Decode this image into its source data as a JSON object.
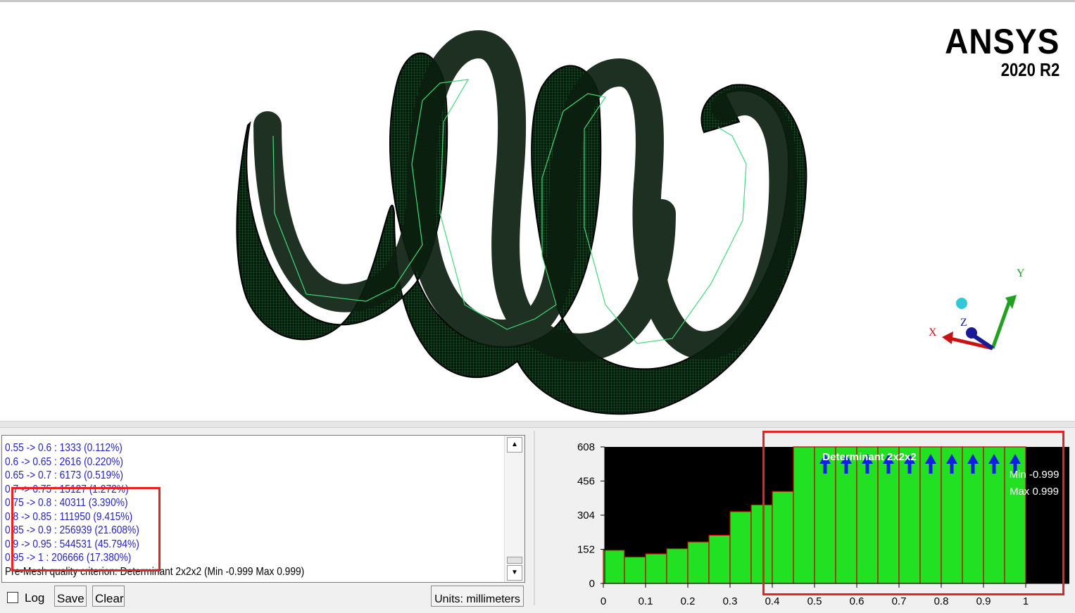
{
  "brand": {
    "name": "ANSYS",
    "version": "2020 R2"
  },
  "axes_triad": {
    "x": "X",
    "y": "Y",
    "z": "Z"
  },
  "log": {
    "lines": [
      "0.55 -> 0.6 : 1333 (0.112%)",
      "0.6 -> 0.65 : 2616 (0.220%)",
      "0.65 -> 0.7 : 6173 (0.519%)",
      "0.7 -> 0.75 : 15127 (1.272%)",
      "0.75 -> 0.8 : 40311 (3.390%)",
      "0.8 -> 0.85 : 111950 (9.415%)",
      "0.85 -> 0.9 : 256939 (21.608%)",
      "0.9 -> 0.95 : 544531 (45.794%)",
      "0.95 -> 1 : 206666 (17.380%)",
      "Pre-Mesh quality criterion: Determinant 2x2x2 (Min -0.999 Max 0.999)"
    ]
  },
  "controls": {
    "log_label": "Log",
    "save_label": "Save",
    "clear_label": "Clear",
    "units": "Units: millimeters"
  },
  "chart_data": {
    "type": "bar",
    "title": "Determinant 2x2x2",
    "min_label": "Min -0.999",
    "max_label": "Max 0.999",
    "yticks": [
      "608",
      "456",
      "304",
      "152",
      "0"
    ],
    "xticks": [
      "0",
      "0.1",
      "0.2",
      "0.3",
      "0.4",
      "0.5",
      "0.6",
      "0.7",
      "0.8",
      "0.9",
      "1"
    ],
    "ylim": [
      0,
      608
    ],
    "bin_width": 0.05,
    "bin_starts": [
      0,
      0.05,
      0.1,
      0.15,
      0.2,
      0.25,
      0.3,
      0.35,
      0.4,
      0.45,
      0.5,
      0.55,
      0.6,
      0.65,
      0.7,
      0.75,
      0.8,
      0.85,
      0.9,
      0.95
    ],
    "values": [
      148,
      118,
      132,
      155,
      185,
      215,
      320,
      350,
      410,
      608,
      608,
      608,
      608,
      608,
      608,
      608,
      608,
      608,
      608,
      608
    ],
    "overflow_bins": [
      0.5,
      0.55,
      0.6,
      0.65,
      0.7,
      0.75,
      0.8,
      0.85,
      0.9,
      0.95
    ],
    "bar_color": "#22e022",
    "bar_edge": "#c00000",
    "background": "#000000"
  },
  "colors": {
    "mesh_fill": "#0d2a12",
    "mesh_line": "#3ddc7a",
    "highlight": "#e8221e",
    "log_text": "#2222cc"
  }
}
